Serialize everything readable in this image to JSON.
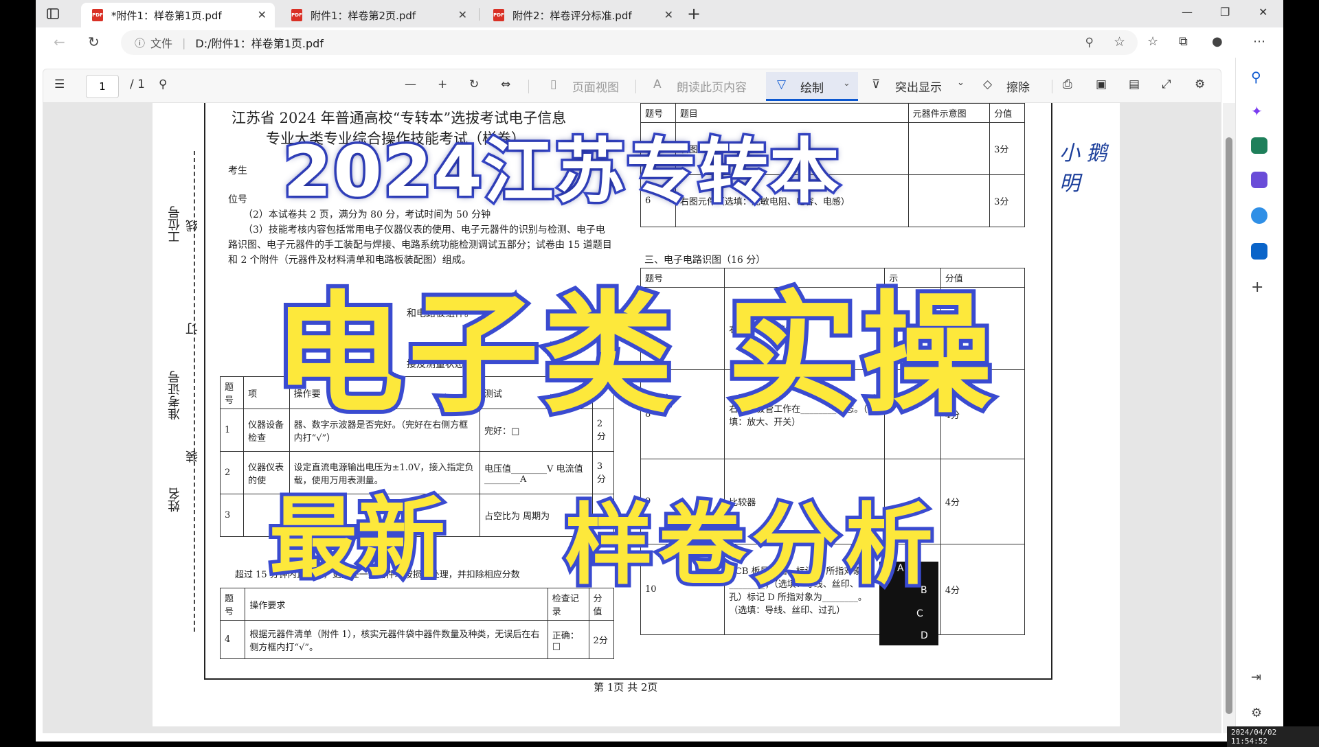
{
  "browser": {
    "tabs": [
      {
        "label": "*附件1：样卷第1页.pdf",
        "active": true
      },
      {
        "label": "附件1：样卷第2页.pdf",
        "active": false
      },
      {
        "label": "附件2：样卷评分标准.pdf",
        "active": false
      }
    ],
    "address": {
      "file_label": "文件",
      "url": "D:/附件1：样卷第1页.pdf"
    }
  },
  "pdf_toolbar": {
    "page_current": "1",
    "page_total": "/ 1",
    "page_view": "页面视图",
    "read_aloud": "朗读此页内容",
    "draw": "绘制",
    "highlight": "突出显示",
    "erase": "擦除"
  },
  "document": {
    "title_line1": "江苏省 2024 年普通高校“专转本”选拔考试电子信息",
    "title_line2": "专业大类专业综合操作技能考试（样卷）",
    "side_labels": {
      "station": "工位号",
      "exam_no": "准考证号",
      "name": "姓名",
      "line": "线",
      "bind": "订",
      "seal": "装"
    },
    "notes": [
      "考生",
      "位号",
      "（2）本试卷共 2 页，满分为 80 分，考试时间为 50 分钟",
      "（3）技能考核内容包括常用电子仪器仪表的使用、电子元器件的识别与检测、电子电",
      "路识图、电子元器件的手工装配与焊接、电路系统功能检测调试五部分；试卷由 15 道题目",
      "和 2 个附件（元器件及材料清单和电路板装配图）组成。",
      "和电路板组件。",
      "接及测量状态。"
    ],
    "left_table": {
      "header": [
        "题号",
        "项",
        "操作要",
        "测试",
        ""
      ],
      "rows": [
        {
          "no": "1",
          "item": "仪器设备检查",
          "req": "器、数字示波器是否完好。（完好在右侧方框内打“√”）",
          "rec": "完好：□",
          "score": "2分"
        },
        {
          "no": "2",
          "item": "仪器仪表的使",
          "req": "设定直流电源输出电压为±1.0V，接入指定负载，使用万用表测量。",
          "rec": "电压值________V 电流值________A",
          "score": "3分"
        },
        {
          "no": "3",
          "item": "",
          "req": "设定",
          "rec": "占空比为 周期为",
          "score": ""
        }
      ]
    },
    "mid_note": "超过 15 分钟内且焊接，更换任一元器件均按损坏处理，并扣除相应分数",
    "left_table2": {
      "header": [
        "题号",
        "操作要求",
        "检查记录",
        "分值"
      ],
      "rows": [
        {
          "no": "4",
          "req": "根据元器件清单（附件 1），核实元器件袋中器件数量及种类，无误后在右侧方框内打“√”。",
          "rec": "正确：□",
          "score": "2分"
        }
      ]
    },
    "right_table1": {
      "header": [
        "题号",
        "题目",
        "元器件示意图",
        "分值"
      ],
      "rows": [
        {
          "no": "",
          "q": "右图元",
          "score": "3分"
        },
        {
          "no": "6",
          "q": "右图元件（选填：光敏电阻、电容、电感）",
          "score": "3分"
        }
      ]
    },
    "section3": "三、电子电路识图（16 分）",
    "right_table2": {
      "header": [
        "题号",
        "",
        "示",
        "分值"
      ],
      "rows": [
        {
          "no": "",
          "q": "右图所示 （选填：",
          "score": "分"
        },
        {
          "no": "8",
          "q": "右图三极管工作在________状态。（选填：放大、开关）",
          "score": "4分"
        },
        {
          "no": "9",
          "q": "比较器",
          "score": "4分"
        },
        {
          "no": "10",
          "q": "PCB 板局部图，标记 B 所指对象为________；（选填：导线、丝印、过孔）标记 D 所指对象为________。（选填：导线、丝印、过孔）",
          "score": "4分"
        }
      ]
    },
    "pcb_labels": [
      "A",
      "B",
      "C",
      "D"
    ],
    "footer": "第 1页  共 2页",
    "handwriting": "小 鹅 明"
  },
  "overlay": {
    "line1": "2024江苏专转本",
    "line2": "电子类 实操",
    "line3a": "最新",
    "line3b": "样卷分析"
  },
  "timestamp": "2024/04/02 11:54:52",
  "colors": {
    "overlay_yellow": "#fde83b",
    "overlay_outline": "#3a4bd0",
    "accent": "#0b57d0"
  }
}
